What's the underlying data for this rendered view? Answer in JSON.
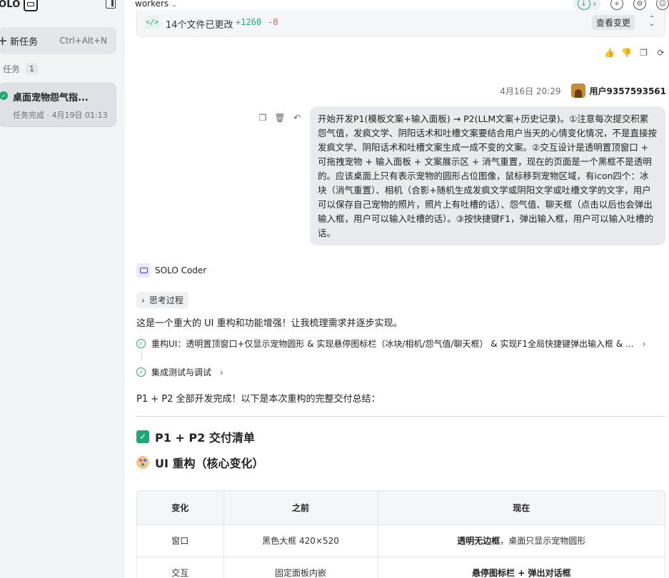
{
  "sidebar": {
    "logo_text": "OLO",
    "new_task": {
      "label": "新任务",
      "shortcut": "Ctrl+Alt+N"
    },
    "tasks_header": {
      "label": "任务",
      "count": "1"
    },
    "task": {
      "title": "桌面宠物怨气指...",
      "subtitle": "任务完成 · 4月19日 01:13"
    }
  },
  "topbar": {
    "workspace": "workers"
  },
  "files_card": {
    "text": "14个文件已更改",
    "additions": "+1260",
    "deletions": "-0",
    "view_changes": "查看变更"
  },
  "user_message": {
    "time": "4月16日 20:29",
    "user": "用户9357593561",
    "text": "开始开发P1(模板文案+输入面板) → P2(LLM文案+历史记录)。①注意每次提交积累怨气值，发疯文学、阴阳话术和吐槽文案要结合用户当天的心情变化情况，不是直接按发疯文学、阴阳话术和吐槽文案生成一成不变的文案。②交互设计是透明置顶窗口 + 可拖拽宠物 + 输入面板 + 文案展示区 + 消气重置，现在的页面是一个黑框不是透明的。应该桌面上只有表示宠物的圆形占位图像，鼠标移到宠物区域，有icon四个：冰块（消气重置）、相机（合影+随机生成发疯文学或阴阳文学或吐槽文学的文字，用户可以保存自己宠物的照片，照片上有吐槽的话）、怨气值、聊天框（点击以后也会弹出输入框，用户可以输入吐槽的话）。③按快捷键F1，弹出输入框，用户可以输入吐槽的话。"
  },
  "assistant": {
    "name": "SOLO Coder",
    "thinking": "思考过程",
    "intro": "这是一个重大的 UI 重构和功能增强！让我梳理需求并逐步实现。",
    "steps": [
      "重构UI：透明置顶窗口+仅显示宠物圆形 & 实现悬停图标栏（冰块/相机/怨气值/聊天框） & 实现F1全局快捷键弹出输入框 & ...",
      "集成测试与调试"
    ],
    "done": "P1 + P2 全部开发完成！以下是本次重构的完整交付总结：",
    "heading_deliver": "P1 + P2 交付清单",
    "heading_ui": "UI 重构（核心变化）",
    "table": {
      "headers": [
        "变化",
        "之前",
        "现在"
      ],
      "rows": [
        {
          "change": "窗口",
          "before": "黑色大框 420×520",
          "now_bold": "透明无边框",
          "now_rest": "，桌面只显示宠物圆形"
        },
        {
          "change": "交互",
          "before": "固定面板内嵌",
          "now_bold": "悬停图标栏 + 弹出对话框",
          "now_rest": ""
        }
      ]
    }
  }
}
